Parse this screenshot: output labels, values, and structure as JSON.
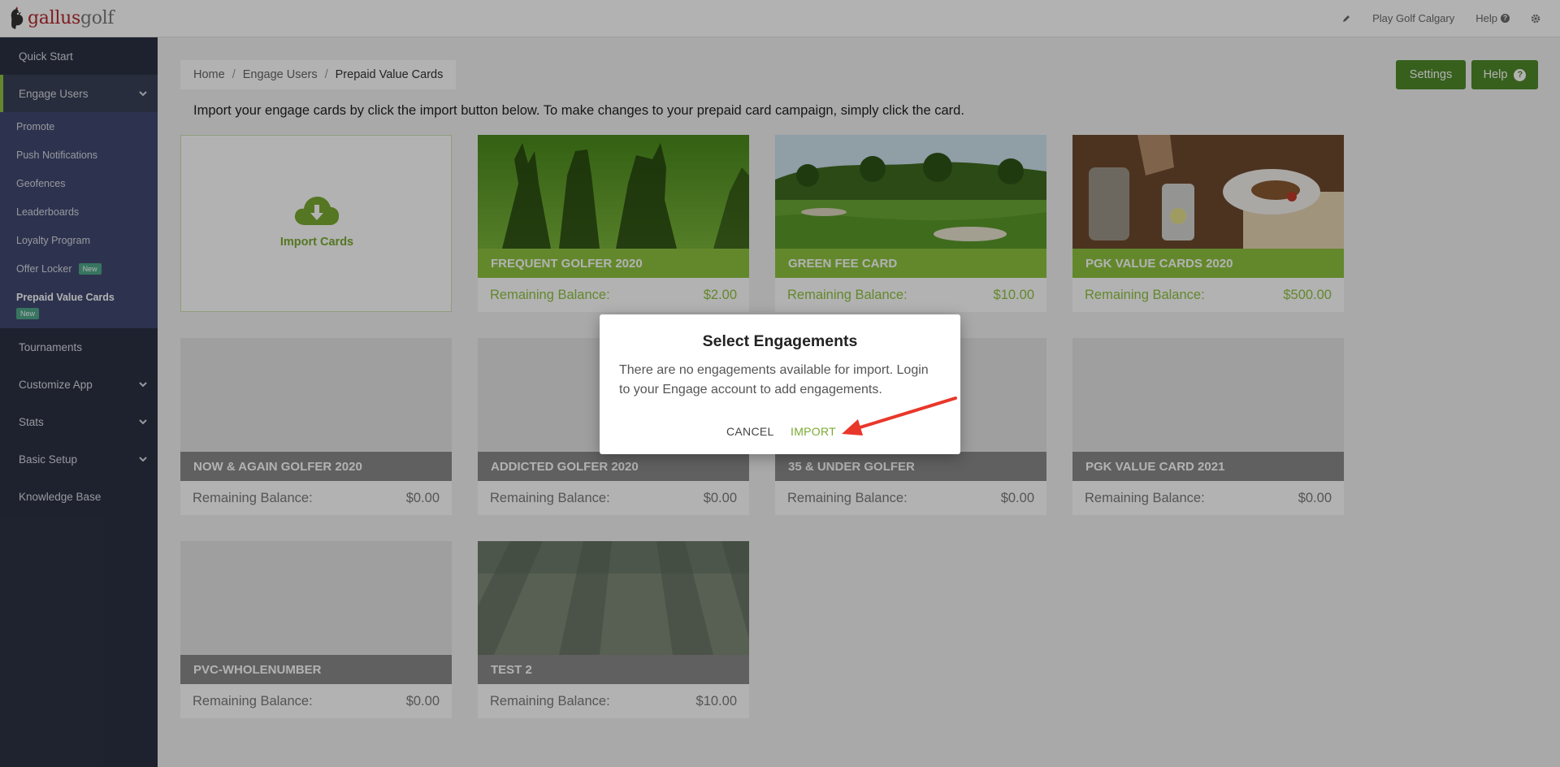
{
  "header": {
    "logo_text_1": "gallus",
    "logo_text_2": "golf",
    "nav": {
      "edit_icon": "pencil-icon",
      "org": "Play Golf Calgary",
      "help": "Help",
      "settings_icon": "gear-icon"
    }
  },
  "sidebar": {
    "items": [
      {
        "label": "Quick Start"
      },
      {
        "label": "Engage Users"
      }
    ],
    "subitems": [
      {
        "label": "Promote"
      },
      {
        "label": "Push Notifications"
      },
      {
        "label": "Geofences"
      },
      {
        "label": "Leaderboards"
      },
      {
        "label": "Loyalty Program"
      },
      {
        "label": "Offer Locker",
        "badge": "New"
      },
      {
        "label": "Prepaid Value Cards",
        "badge": "New"
      }
    ],
    "bottom_items": [
      {
        "label": "Tournaments"
      },
      {
        "label": "Customize App"
      },
      {
        "label": "Stats"
      },
      {
        "label": "Basic Setup"
      },
      {
        "label": "Knowledge Base"
      }
    ]
  },
  "breadcrumb": [
    "Home",
    "Engage Users",
    "Prepaid Value Cards"
  ],
  "buttons": {
    "settings": "Settings",
    "help": "Help"
  },
  "intro": "Import your engage cards by click the import button below. To make changes to your prepaid card campaign, simply click the card.",
  "import_card": {
    "label": "Import Cards",
    "icon": "cloud-download-icon"
  },
  "balance_label": "Remaining Balance:",
  "cards": [
    {
      "title": "FREQUENT GOLFER 2020",
      "balance": "$2.00",
      "image": "golfer-shadows"
    },
    {
      "title": "GREEN FEE CARD",
      "balance": "$10.00",
      "image": "golf-course"
    },
    {
      "title": "PGK VALUE CARDS 2020",
      "balance": "$500.00",
      "image": "restaurant-table"
    },
    {
      "title": "NOW & AGAIN GOLFER 2020",
      "balance": "$0.00"
    },
    {
      "title": "ADDICTED GOLFER 2020",
      "balance": "$0.00"
    },
    {
      "title": "35 & UNDER GOLFER",
      "balance": "$0.00"
    },
    {
      "title": "PGK VALUE CARD 2021",
      "balance": "$0.00"
    },
    {
      "title": "PVC-WHOLENUMBER",
      "balance": "$0.00"
    },
    {
      "title": "TEST 2",
      "balance": "$10.00",
      "image": "mowed-grass"
    }
  ],
  "modal": {
    "title": "Select Engagements",
    "body": "There are no engagements available for import. Login to your Engage account to add engagements.",
    "cancel": "CANCEL",
    "import": "IMPORT"
  },
  "colors": {
    "brand_green": "#8fc33f",
    "button_green": "#4f8a2a",
    "sidebar_bg": "#2c3244",
    "submenu_bg": "#414a71",
    "annotation_arrow": "#e8372a"
  }
}
